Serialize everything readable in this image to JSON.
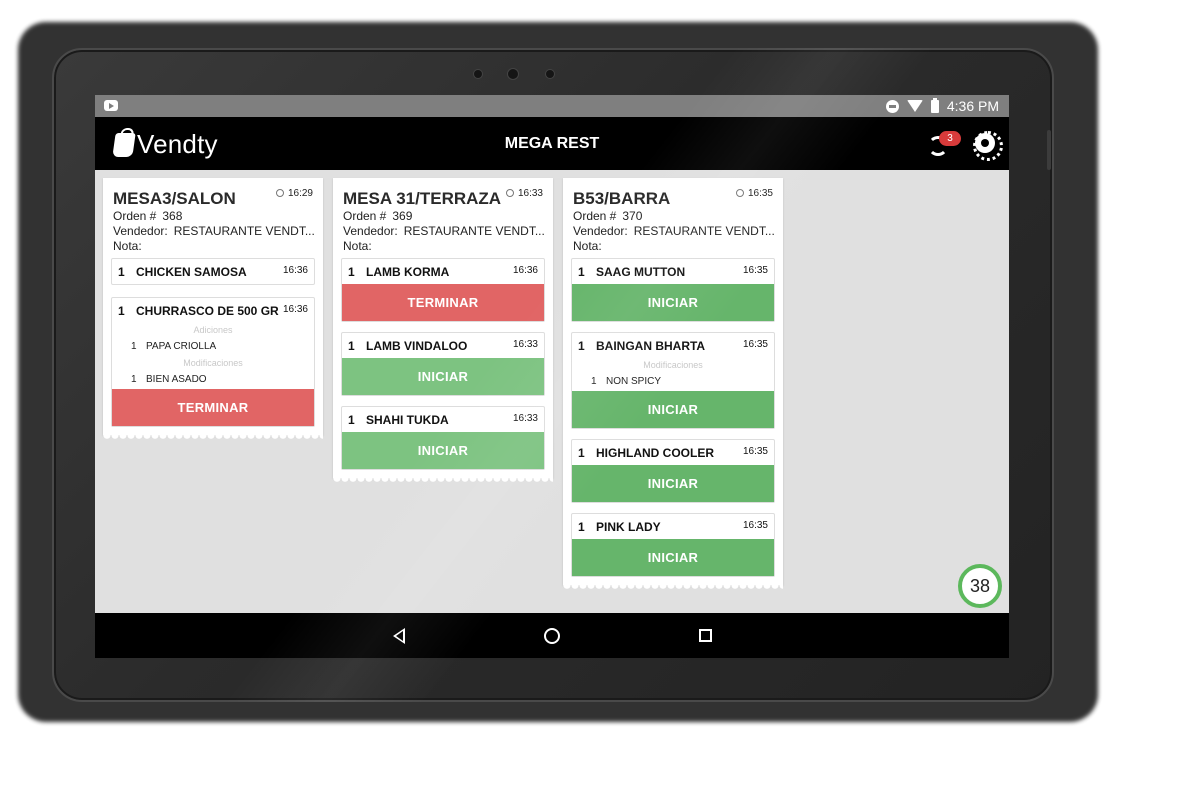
{
  "status_bar": {
    "time": "4:36 PM"
  },
  "app": {
    "brand": "Vendty",
    "title": "MEGA REST",
    "sync_count": "3"
  },
  "labels": {
    "order": "Orden #",
    "vendor": "Vendedor:",
    "note": "Nota:",
    "adiciones": "Adiciones",
    "modificaciones": "Modificaciones"
  },
  "tickets": [
    {
      "title": "MESA3/SALON",
      "time": "16:29",
      "order_no": "368",
      "vendor": "RESTAURANTE VENDT...",
      "items": [
        {
          "qty": "1",
          "name": "CHICKEN SAMOSA",
          "time": "16:36"
        },
        {
          "qty": "1",
          "name": "CHURRASCO DE 500 GR",
          "time": "16:36",
          "adiciones": [
            {
              "qty": "1",
              "name": "PAPA CRIOLLA"
            }
          ],
          "modificaciones": [
            {
              "qty": "1",
              "name": "BIEN ASADO"
            }
          ],
          "button": "TERMINAR"
        }
      ]
    },
    {
      "title": "MESA 31/TERRAZA",
      "time": "16:33",
      "order_no": "369",
      "vendor": "RESTAURANTE VENDT...",
      "items": [
        {
          "qty": "1",
          "name": "LAMB KORMA",
          "time": "16:36",
          "button": "TERMINAR"
        },
        {
          "qty": "1",
          "name": "LAMB VINDALOO",
          "time": "16:33",
          "button": "INICIAR"
        },
        {
          "qty": "1",
          "name": "SHAHI TUKDA",
          "time": "16:33",
          "button": "INICIAR"
        }
      ]
    },
    {
      "title": "B53/BARRA",
      "time": "16:35",
      "order_no": "370",
      "vendor": "RESTAURANTE VENDT...",
      "items": [
        {
          "qty": "1",
          "name": "SAAG MUTTON",
          "time": "16:35",
          "button": "INICIAR"
        },
        {
          "qty": "1",
          "name": "BAINGAN BHARTA",
          "time": "16:35",
          "modificaciones": [
            {
              "qty": "1",
              "name": "NON SPICY"
            }
          ],
          "button": "INICIAR"
        },
        {
          "qty": "1",
          "name": "HIGHLAND COOLER",
          "time": "16:35",
          "button": "INICIAR"
        },
        {
          "qty": "1",
          "name": "PINK LADY",
          "time": "16:35",
          "button": "INICIAR"
        }
      ]
    }
  ],
  "counter": "38",
  "colors": {
    "accent_green": "#66b56b",
    "accent_red": "#e16565",
    "badge_red": "#d83b3b",
    "counter_ring": "#5cb85c"
  }
}
